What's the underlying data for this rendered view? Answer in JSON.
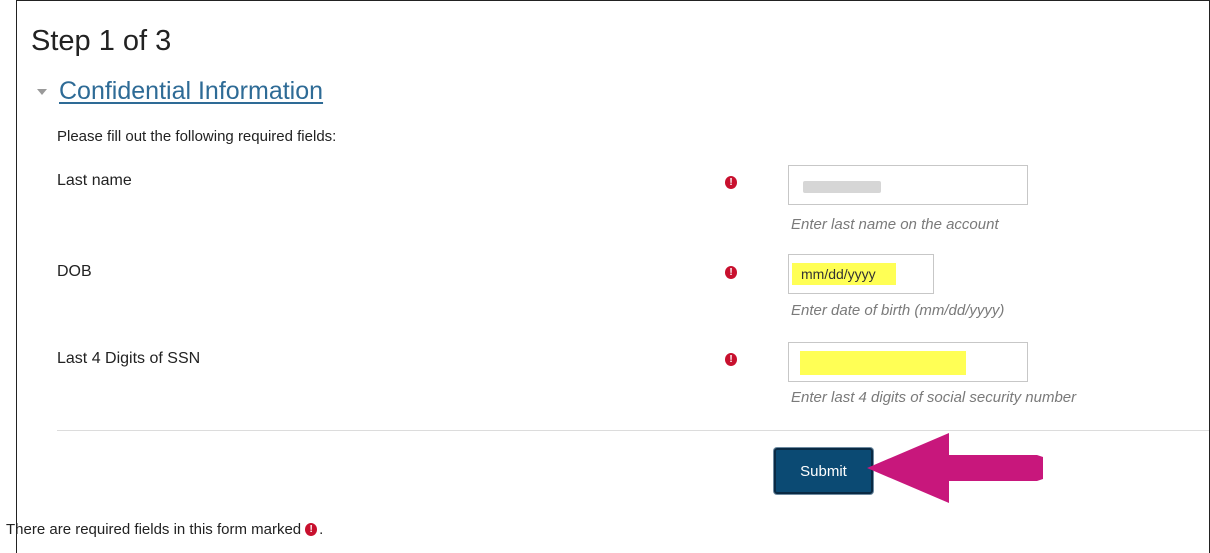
{
  "form": {
    "step_title": "Step 1 of 3",
    "section_title": "Confidential Information",
    "intro": "Please fill out the following required fields:",
    "required_mark": "!",
    "fields": [
      {
        "label": "Last name",
        "value": "",
        "help": "Enter last name on the account"
      },
      {
        "label": "DOB",
        "placeholder": "mm/dd/yyyy",
        "help": "Enter date of birth (mm/dd/yyyy)"
      },
      {
        "label": "Last 4 Digits of SSN",
        "value": "",
        "help": "Enter last 4 digits of social security number"
      }
    ],
    "submit_label": "Submit",
    "footer_note": "There are required fields in this form marked",
    "footer_period": "."
  },
  "colors": {
    "section_link": "#2e6b96",
    "required": "#c8102e",
    "submit_bg": "#0b4a73",
    "highlight": "#ffff55",
    "annotation_arrow": "#c8177c"
  }
}
